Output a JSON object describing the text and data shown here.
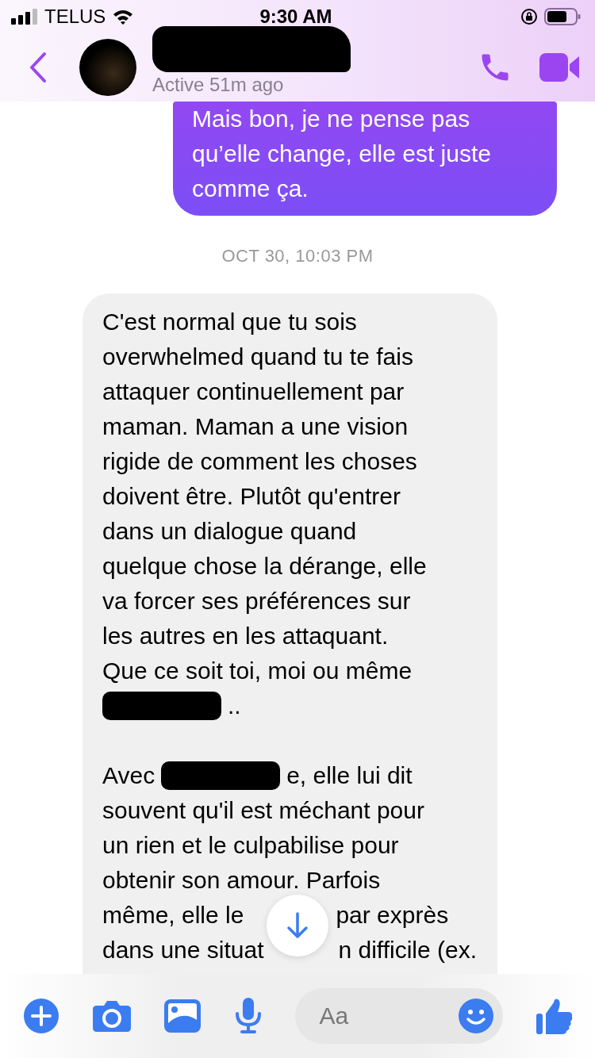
{
  "status_bar": {
    "carrier": "TELUS",
    "time": "9:30 AM"
  },
  "header": {
    "status": "Active 51m ago"
  },
  "messages": [
    {
      "kind": "sent",
      "lines": [
        "Mais bon, je ne pense pas",
        "qu’elle change, elle est juste",
        "comme ça."
      ]
    },
    {
      "kind": "timestamp",
      "text": "OCT 30, 10:03 PM"
    },
    {
      "kind": "received",
      "paragraphs": [
        {
          "lines": [
            [
              {
                "kind": "text",
                "text": "C'est normal que tu sois"
              }
            ],
            [
              {
                "kind": "text",
                "text": "overwhelmed quand tu te fais"
              }
            ],
            [
              {
                "kind": "text",
                "text": "attaquer continuellement par"
              }
            ],
            [
              {
                "kind": "text",
                "text": "maman. Maman a une vision"
              }
            ],
            [
              {
                "kind": "text",
                "text": "rigide de comment les choses"
              }
            ],
            [
              {
                "kind": "text",
                "text": "doivent être. Plutôt qu'entrer"
              }
            ],
            [
              {
                "kind": "text",
                "text": "dans un dialogue quand"
              }
            ],
            [
              {
                "kind": "text",
                "text": "quelque chose la dérange, elle"
              }
            ],
            [
              {
                "kind": "text",
                "text": "va forcer ses préférences sur"
              }
            ],
            [
              {
                "kind": "text",
                "text": "les autres en les attaquant."
              }
            ],
            [
              {
                "kind": "text",
                "text": "Que ce soit toi, moi ou même"
              }
            ],
            [
              {
                "kind": "redaction"
              },
              {
                "kind": "text",
                "text": ".."
              }
            ]
          ]
        },
        {
          "lines": [
            [
              {
                "kind": "text",
                "text": "Avec"
              },
              {
                "kind": "redaction"
              },
              {
                "kind": "text",
                "text": "e, elle lui dit"
              }
            ],
            [
              {
                "kind": "text",
                "text": "souvent qu'il est méchant pour"
              }
            ],
            [
              {
                "kind": "text",
                "text": "un rien et le culpabilise pour"
              }
            ],
            [
              {
                "kind": "text",
                "text": "obtenir son amour. Parfois"
              }
            ],
            [
              {
                "kind": "text",
                "text": "même, elle le"
              },
              {
                "kind": "covered"
              },
              {
                "kind": "text",
                "text": "par exprès"
              }
            ],
            [
              {
                "kind": "text",
                "text": "dans une situat"
              },
              {
                "kind": "covered"
              },
              {
                "kind": "text",
                "text": "n difficile (ex."
              }
            ]
          ]
        }
      ]
    }
  ],
  "composer": {
    "placeholder": "Aa"
  }
}
